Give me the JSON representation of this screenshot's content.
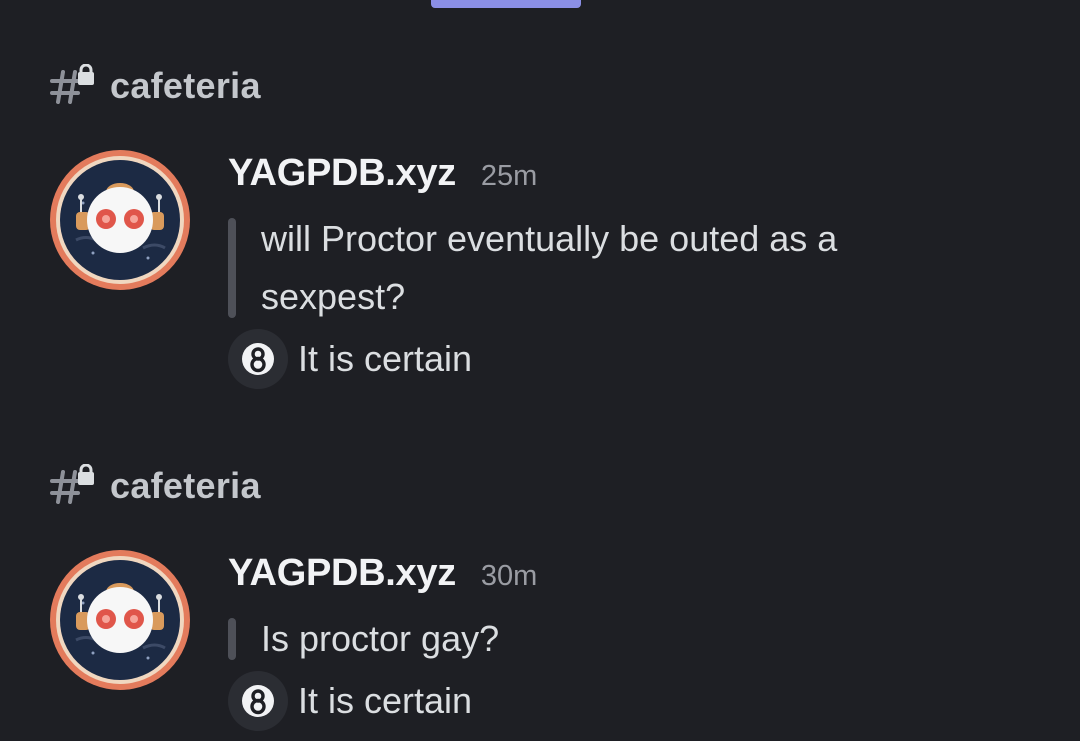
{
  "messages": [
    {
      "channel": "cafeteria",
      "author": "YAGPDB.xyz",
      "timestamp": "25m",
      "question_lines": [
        "will Proctor eventually be outed as a",
        "sexpest?"
      ],
      "answer": "It is certain",
      "answer_icon": "eight-ball-icon"
    },
    {
      "channel": "cafeteria",
      "author": "YAGPDB.xyz",
      "timestamp": "30m",
      "question_lines": [
        "Is proctor gay?"
      ],
      "answer": "It is certain",
      "answer_icon": "eight-ball-icon"
    }
  ],
  "colors": {
    "background": "#1e1f24",
    "accent": "#8b8fe6",
    "quote_bar": "#4e5058",
    "avatar_ring": "#e37b5c"
  }
}
